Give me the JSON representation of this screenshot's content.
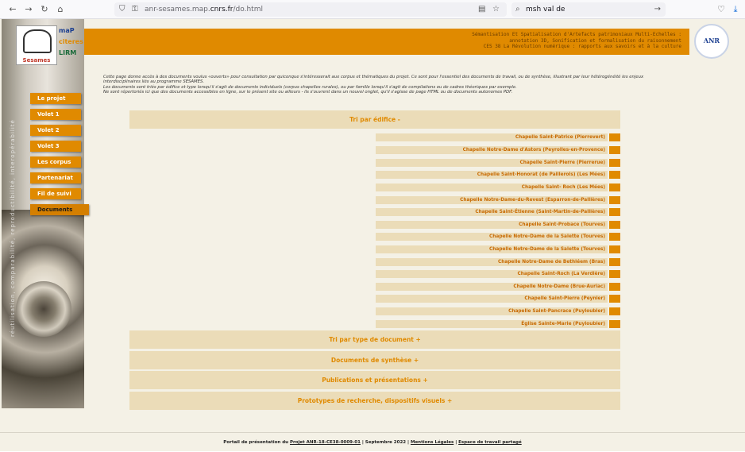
{
  "browser": {
    "url_prefix": "anr-sesames.map.",
    "url_domain": "cnrs.fr",
    "url_path": "/do.html",
    "search_value": "msh val de"
  },
  "site": {
    "logo_label": "Sesames",
    "partner_logos": [
      "maP",
      "citeres",
      "LIRM"
    ],
    "header_lines": [
      "Sémantisation Et Spatialisation d'Artefacts patrimoniaux Multi-Echelles :",
      "annotation 3D, Sonification et formalisation du raisonnement",
      "CES 38 La Révolution numérique : rapports aux savoirs et à la culture"
    ],
    "anr_label": "ANR",
    "vertical_text": "réutilisation, comparabilité, reproductibilité, interopérabilité",
    "intro_lines": [
      "Cette page donne accès à des documents voulus «ouverts» pour consultation par quiconque s'intéresserait aux corpus et thématiques du projet. Ce sont pour l'essentiel des documents de travail, ou de synthèse, illustrant par leur hétérogénéité les enjeux",
      "interdisciplinaires liés au programme SESAMES.",
      "Les documents sont triés par édifice et type lorsqu'il s'agit de documents individuels (corpus chapelles rurales), ou par famille lorsqu'il s'agit de compilations ou de cadres théoriques par exemple.",
      "Ne sont répertoriés ici que des documents accessibles en ligne, sur le présent site ou ailleurs - ils s'ouvrent dans un nouvel onglet, qu'il s'agisse de page HTML ou de documents autonomes PDF."
    ]
  },
  "menu": [
    {
      "label": "Le projet"
    },
    {
      "label": "Volet 1"
    },
    {
      "label": "Volet 2"
    },
    {
      "label": "Volet 3"
    },
    {
      "label": "Les corpus"
    },
    {
      "label": "Partenariat"
    },
    {
      "label": "Fil de suivi"
    },
    {
      "label": "Documents"
    }
  ],
  "sections": {
    "by_building": "Tri par édifice -",
    "by_type": "Tri par type de document +",
    "synthesis": "Documents de synthèse +",
    "publications": "Publications et présentations +",
    "prototypes": "Prototypes de recherche, dispositifs visuels +"
  },
  "buildings": [
    "Chapelle Saint-Patrice (Pierrevert)",
    "Chapelle Notre-Dame d'Astors (Peyrolles-en-Provence)",
    "Chapelle Saint-Pierre (Pierrerue)",
    "Chapelle Saint-Honorat (de Paillerols) (Les Mées)",
    "Chapelle Saint- Roch (Les Mées)",
    "Chapelle Notre-Dame-du-Revest (Esparron-de-Pallières)",
    "Chapelle Saint-Étienne (Saint-Martin-de-Pallières)",
    "Chapelle Saint-Probace (Tourves)",
    "Chapelle Notre-Dame de la Salette (Tourves)",
    "Chapelle Notre-Dame de la Salette (Tourves)",
    "Chapelle Notre-Dame de Bethléem (Bras)",
    "Chapelle Saint-Roch (La Verdière)",
    "Chapelle Notre-Dame (Brue-Auriac)",
    "Chapelle Saint-Pierre (Peynier)",
    "Chapelle Saint-Pancrace (Puyloubier)",
    "Église Sainte-Marie (Puyloubier)"
  ],
  "footer": {
    "prefix": "Portail de présentation du",
    "project_link": "Projet ANR-18-CE38-0009-01",
    "date": "| Septembre 2022 |",
    "legal_link": "Mentions Légales",
    "sep": "|",
    "workspace_link": "Espace de travail partagé"
  },
  "colors": {
    "accent": "#e08a00",
    "panel": "#ebdcb8",
    "background": "#f4f1e6"
  }
}
